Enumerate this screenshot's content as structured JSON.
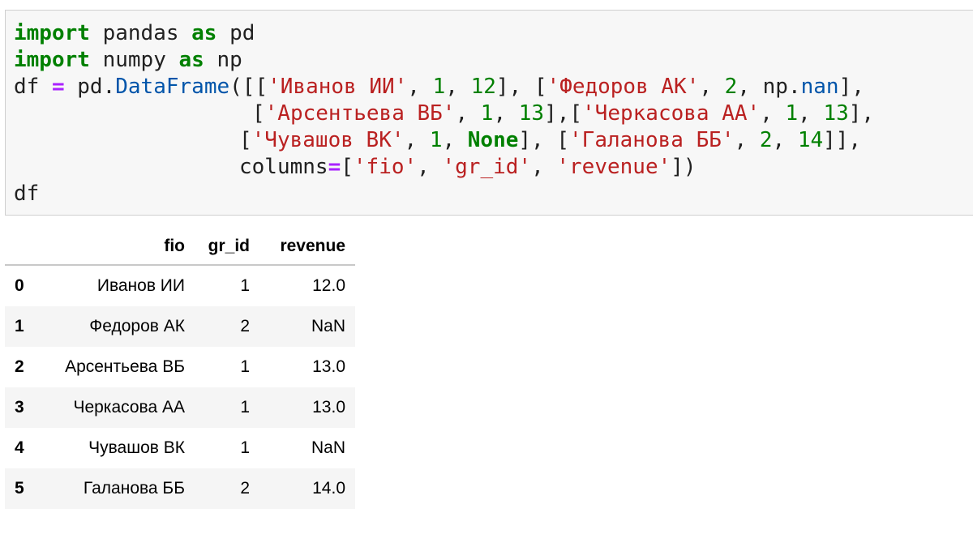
{
  "code_cell": {
    "lines": [
      {
        "prefix_kw": "import",
        "mid": " pandas ",
        "kw2": "as",
        "tail": " pd"
      },
      {
        "prefix_kw": "import",
        "mid": " numpy ",
        "kw2": "as",
        "tail": " np"
      }
    ],
    "line3": {
      "a": "df ",
      "eq": "=",
      "b": " pd.",
      "cls": "DataFrame",
      "c": "([[",
      "s1": "'Иванов ИИ'",
      "d": ", ",
      "n1": "1",
      "e": ", ",
      "n2": "12",
      "f": "], [",
      "s2": "'Федоров АК'",
      "g": ", ",
      "n3": "2",
      "h": ", np.",
      "nan": "nan",
      "i": "],"
    },
    "line4": {
      "a": "[",
      "s1": "'Арсентьева ВБ'",
      "b": ", ",
      "n1": "1",
      "c": ", ",
      "n2": "13",
      "d": "],[",
      "s2": "'Черкасова АА'",
      "e": ", ",
      "n3": "1",
      "f": ", ",
      "n4": "13",
      "g": "],"
    },
    "line5": {
      "a": "[",
      "s1": "'Чувашов ВК'",
      "b": ", ",
      "n1": "1",
      "c": ", ",
      "none": "None",
      "d": "], [",
      "s2": "'Галанова ББ'",
      "e": ", ",
      "n2": "2",
      "f": ", ",
      "n3": "14",
      "g": "]],"
    },
    "line6": {
      "a": "columns",
      "eq": "=",
      "b": "[",
      "s1": "'fio'",
      "c": ", ",
      "s2": "'gr_id'",
      "d": ", ",
      "s3": "'revenue'",
      "e": "])"
    },
    "line7": "df"
  },
  "dataframe": {
    "columns": [
      "fio",
      "gr_id",
      "revenue"
    ],
    "rows": [
      {
        "index": "0",
        "fio": "Иванов ИИ",
        "gr_id": "1",
        "revenue": "12.0"
      },
      {
        "index": "1",
        "fio": "Федоров АК",
        "gr_id": "2",
        "revenue": "NaN"
      },
      {
        "index": "2",
        "fio": "Арсентьева ВБ",
        "gr_id": "1",
        "revenue": "13.0"
      },
      {
        "index": "3",
        "fio": "Черкасова АА",
        "gr_id": "1",
        "revenue": "13.0"
      },
      {
        "index": "4",
        "fio": "Чувашов ВК",
        "gr_id": "1",
        "revenue": "NaN"
      },
      {
        "index": "5",
        "fio": "Галанова ББ",
        "gr_id": "2",
        "revenue": "14.0"
      }
    ]
  }
}
